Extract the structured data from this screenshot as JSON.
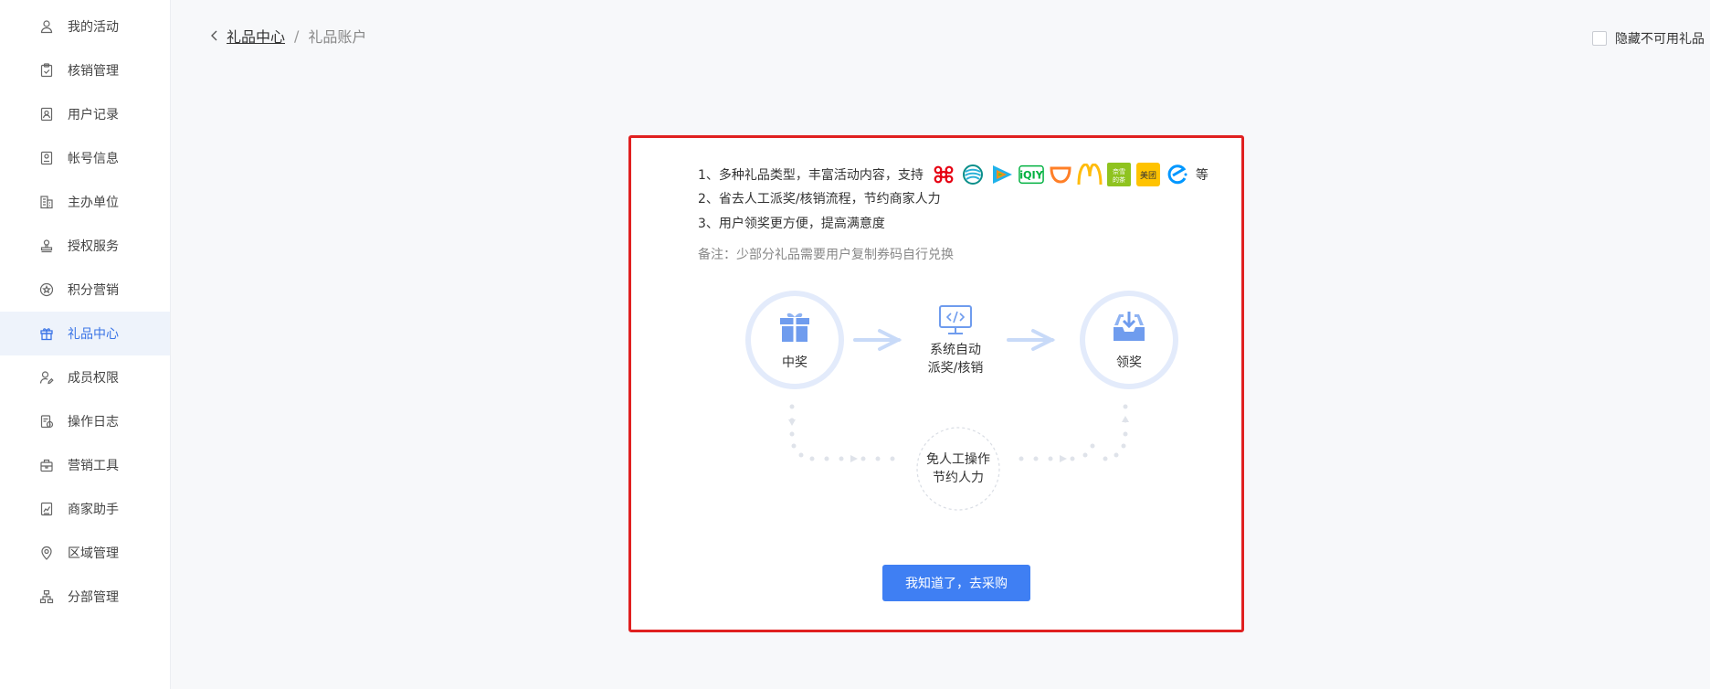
{
  "sidebar": {
    "items": [
      {
        "label": "我的活动",
        "icon": "user-icon"
      },
      {
        "label": "核销管理",
        "icon": "clipboard-check-icon"
      },
      {
        "label": "用户记录",
        "icon": "contact-card-icon"
      },
      {
        "label": "帐号信息",
        "icon": "id-card-icon"
      },
      {
        "label": "主办单位",
        "icon": "building-icon"
      },
      {
        "label": "授权服务",
        "icon": "stamp-icon"
      },
      {
        "label": "积分营销",
        "icon": "star-badge-icon"
      },
      {
        "label": "礼品中心",
        "icon": "gift-icon",
        "active": true
      },
      {
        "label": "成员权限",
        "icon": "user-edit-icon"
      },
      {
        "label": "操作日志",
        "icon": "log-icon"
      },
      {
        "label": "营销工具",
        "icon": "toolbox-icon"
      },
      {
        "label": "商家助手",
        "icon": "chart-doc-icon"
      },
      {
        "label": "区域管理",
        "icon": "location-pin-icon"
      },
      {
        "label": "分部管理",
        "icon": "org-chart-icon"
      }
    ]
  },
  "breadcrumb": {
    "back_icon": "chevron-left-icon",
    "parent": "礼品中心",
    "separator": "/",
    "current": "礼品账户"
  },
  "hide_unavailable": {
    "label": "隐藏不可用礼品",
    "checked": false
  },
  "intro": {
    "line1": "1、多种礼品类型，丰富活动内容，支持",
    "line1_suffix": "等",
    "line2": "2、省去人工派奖/核销流程，节约商家人力",
    "line3": "3、用户领奖更方便，提高满意度",
    "note": "备注：少部分礼品需要用户复制券码自行兑换",
    "brand_logos": [
      "china-unicom-logo-icon",
      "china-mobile-logo-icon",
      "tencent-video-logo-icon",
      "iqiyi-logo-icon",
      "didi-logo-icon",
      "mcdonalds-logo-icon",
      "naixue-logo-icon",
      "meituan-logo-icon",
      "eleme-logo-icon"
    ],
    "iqiyi_text": "iQIY",
    "naixue_text": "奈雪的茶",
    "meituan_text": "美团"
  },
  "flow": {
    "step1": "中奖",
    "step2_line1": "系统自动",
    "step2_line2": "派奖/核销",
    "step3": "领奖",
    "bottom_line1": "免人工操作",
    "bottom_line2": "节约人力"
  },
  "cta": {
    "label": "我知道了，去采购"
  },
  "colors": {
    "accent": "#3f7ff3",
    "highlight_border": "#e02020",
    "active_bg": "#eef3fb",
    "soft_blue": "#e3ebfb"
  }
}
